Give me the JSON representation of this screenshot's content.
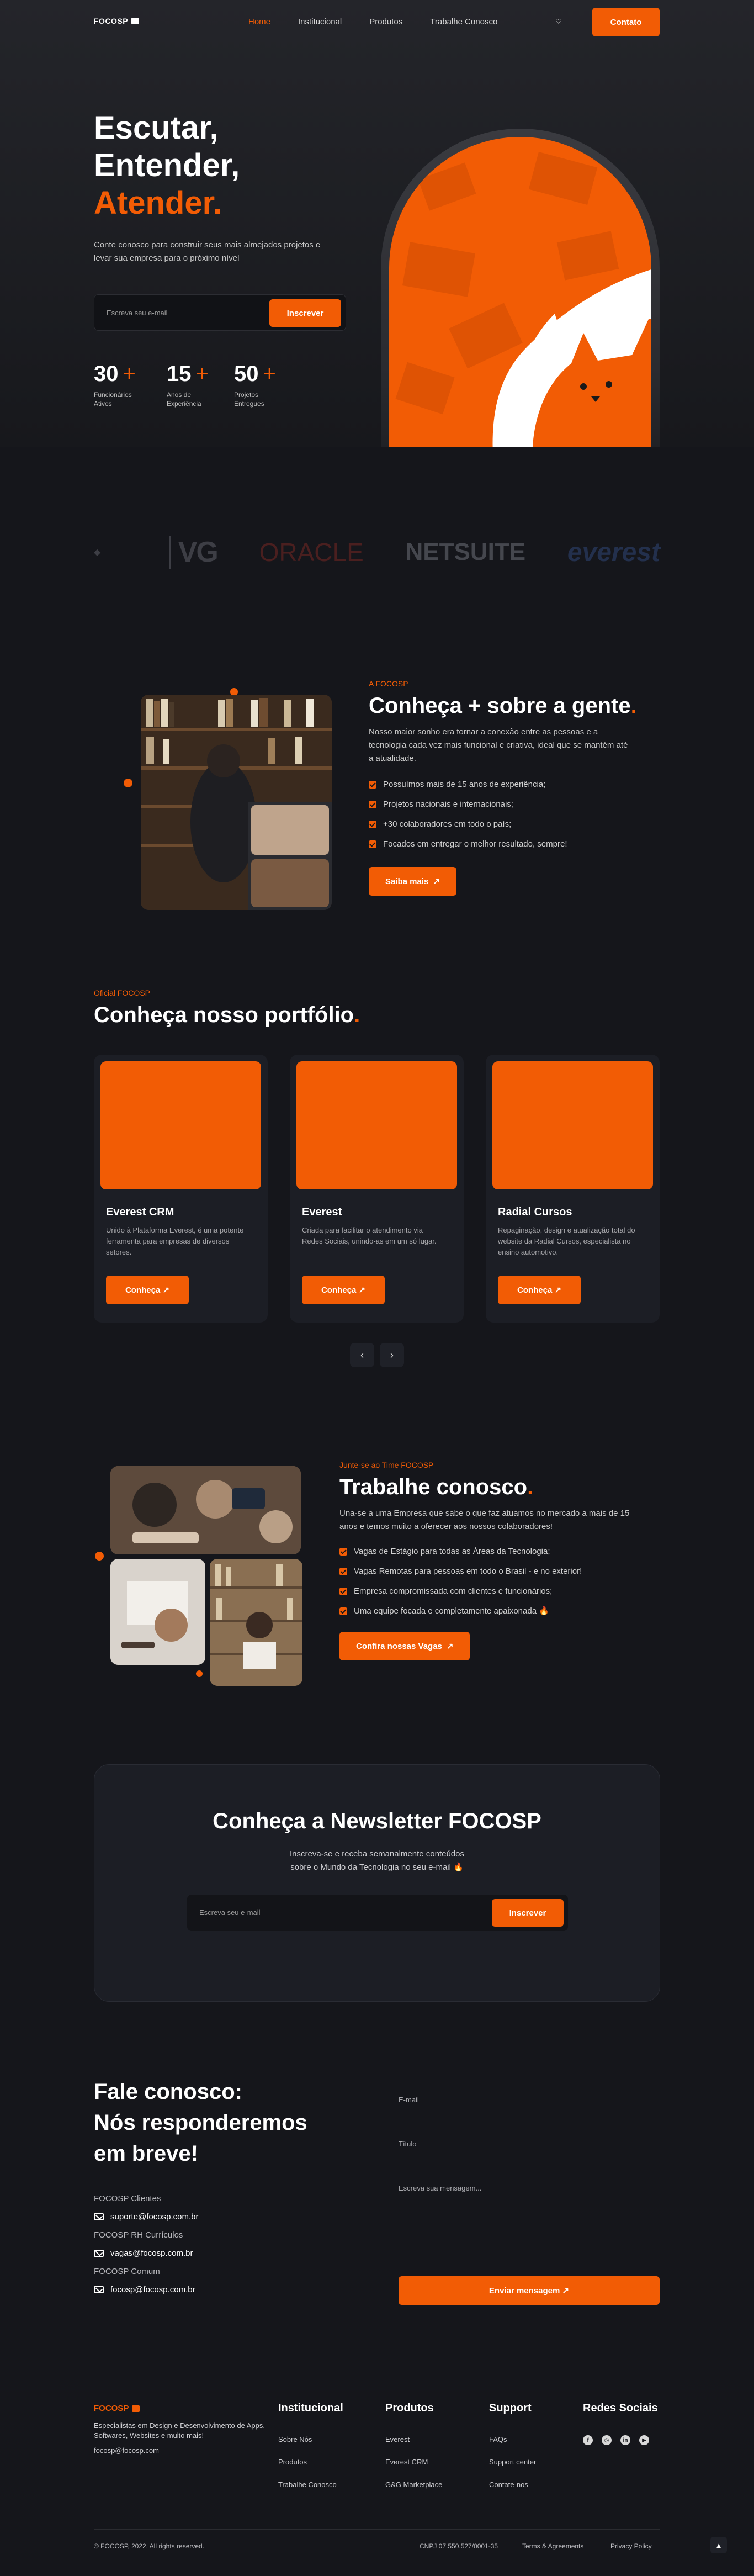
{
  "nav": {
    "logo": "FOCOSP",
    "items": [
      "Home",
      "Institucional",
      "Produtos",
      "Trabalhe Conosco"
    ],
    "contact_button": "Contato"
  },
  "hero": {
    "title_line1": "Escutar,",
    "title_line2": "Entender,",
    "title_line3": "Atender",
    "title_dot": ".",
    "description": "Conte conosco para construir seus mais almejados projetos e levar sua empresa para o próximo nível",
    "email_placeholder": "Escreva seu e-mail",
    "subscribe_button": "Inscrever",
    "stats": [
      {
        "number": "30",
        "label": "Funcionários Ativos"
      },
      {
        "number": "15",
        "label": "Anos de Experiência"
      },
      {
        "number": "50",
        "label": "Projetos Entregues"
      }
    ],
    "plus": "+"
  },
  "brands": [
    "VG",
    "ORACLE",
    "NETSUITE",
    "everest"
  ],
  "about": {
    "eyebrow": "A FOCOSP",
    "title": "Conheça + sobre a gente",
    "dot": ".",
    "description": "Nosso maior sonho era tornar a conexão entre as pessoas e a tecnologia cada vez mais funcional e criativa, ideal que se mantém até a atualidade.",
    "items": [
      "Possuímos mais de 15 anos de experiência;",
      "Projetos nacionais e internacionais;",
      "+30 colaboradores em todo o país;",
      "Focados em entregar o melhor resultado, sempre!"
    ],
    "button": "Saiba mais"
  },
  "portfolio": {
    "eyebrow": "Oficial FOCOSP",
    "title": "Conheça nosso portfólio",
    "dot": ".",
    "cards": [
      {
        "title": "Everest CRM",
        "desc": "Unido à Plataforma Everest, é uma potente ferramenta para empresas de diversos setores.",
        "button": "Conheça"
      },
      {
        "title": "Everest",
        "desc": "Criada para facilitar o atendimento via Redes Sociais, unindo-as em um só lugar.",
        "button": "Conheça"
      },
      {
        "title": "Radial Cursos",
        "desc": "Repaginação, design e atualização total do website da Radial Cursos, especialista no ensino automotivo.",
        "button": "Conheça"
      }
    ]
  },
  "work": {
    "eyebrow": "Junte-se ao Time FOCOSP",
    "title": "Trabalhe conosco",
    "dot": ".",
    "description": "Una-se a uma Empresa que sabe o que faz atuamos no mercado a mais de 15 anos e temos muito a oferecer aos nossos colaboradores!",
    "items": [
      "Vagas de Estágio para todas as Áreas da Tecnologia;",
      "Vagas Remotas para pessoas em todo o Brasil - e no exterior!",
      "Empresa compromissada com clientes e funcionários;",
      "Uma equipe focada e completamente apaixonada 🔥"
    ],
    "button": "Confira nossas Vagas"
  },
  "newsletter": {
    "title": "Conheça a Newsletter FOCOSP",
    "desc_line1": "Inscreva-se e receba semanalmente conteúdos",
    "desc_line2": "sobre o Mundo da Tecnologia no seu e-mail 🔥",
    "placeholder": "Escreva seu e-mail",
    "button": "Inscrever"
  },
  "contact": {
    "title_line1": "Fale conosco:",
    "title_line2": "Nós responderemos",
    "title_line3": "em breve!",
    "groups": [
      {
        "label": "FOCOSP Clientes",
        "email": "suporte@focosp.com.br"
      },
      {
        "label": "FOCOSP RH Currículos",
        "email": "vagas@focosp.com.br"
      },
      {
        "label": "FOCOSP Comum",
        "email": "focosp@focosp.com.br"
      }
    ],
    "email_placeholder": "E-mail",
    "title_placeholder": "Título",
    "message_placeholder": "Escreva sua mensagem...",
    "send_button": "Enviar mensagem"
  },
  "footer": {
    "logo": "FOCOSP",
    "about": "Especialistas em Design e Desenvolvimento de Apps, Softwares, Websites e muito mais!",
    "email": "focosp@focosp.com",
    "cols": [
      {
        "title": "Institucional",
        "links": [
          "Sobre Nós",
          "Produtos",
          "Trabalhe Conosco"
        ]
      },
      {
        "title": "Produtos",
        "links": [
          "Everest",
          "Everest CRM",
          "G&G Marketplace"
        ]
      },
      {
        "title": "Support",
        "links": [
          "FAQs",
          "Support center",
          "Contate-nos"
        ]
      },
      {
        "title": "Redes Sociais",
        "links": []
      }
    ],
    "copyright": "© FOCOSP, 2022. All rights reserved.",
    "cnpj": "CNPJ 07.550.527/0001-35",
    "terms": "Terms & Agreements",
    "privacy": "Privacy Policy"
  },
  "colors": {
    "accent": "#f25c05",
    "background": "#15161b",
    "card": "#1c1e25"
  }
}
